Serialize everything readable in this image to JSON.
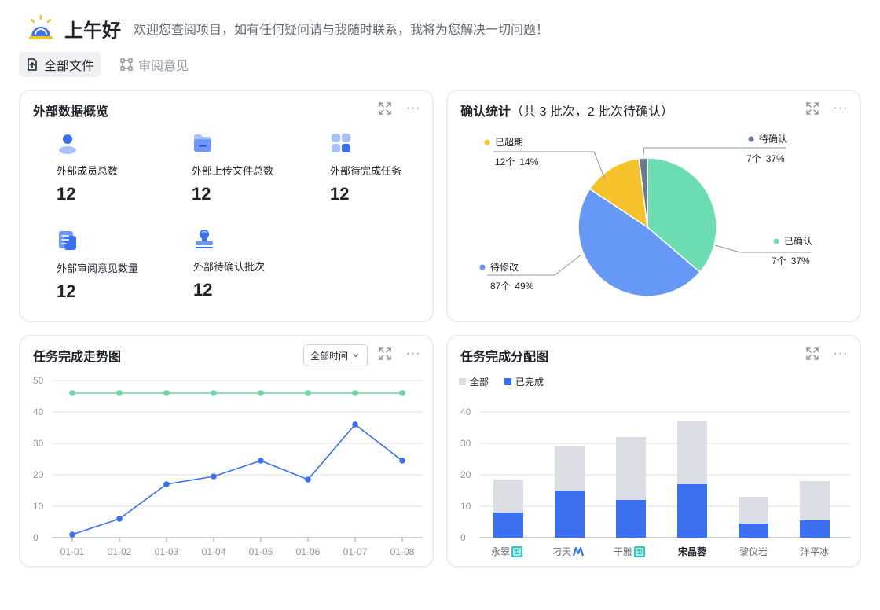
{
  "header": {
    "greeting": "上午好",
    "subtitle": "欢迎您查阅项目，如有任何疑问请与我随时联系，我将为您解决一切问题！"
  },
  "tabs": [
    {
      "label": "全部文件",
      "icon": "upload-file-icon",
      "active": true
    },
    {
      "label": "审阅意见",
      "icon": "annotation-icon",
      "active": false
    }
  ],
  "overview": {
    "title": "外部数据概览",
    "stats": [
      {
        "label": "外部成员总数",
        "value": "12",
        "icon": "user-icon"
      },
      {
        "label": "外部上传文件总数",
        "value": "12",
        "icon": "folder-icon"
      },
      {
        "label": "外部待完成任务",
        "value": "12",
        "icon": "apps-grid-icon"
      },
      {
        "label": "外部审阅意见数量",
        "value": "12",
        "icon": "document-list-icon"
      },
      {
        "label": "外部待确认批次",
        "value": "12",
        "icon": "stamp-icon"
      }
    ]
  },
  "confirm": {
    "title": "确认统计",
    "title_detail": "（共 3 批次，2 批次待确认）",
    "colors": {
      "confirmed": "#6bddb0",
      "to_edit": "#6699f5",
      "overdue": "#f6c22c",
      "pending": "#6b7a92"
    }
  },
  "trend": {
    "title": "任务完成走势图",
    "filter": "全部时间"
  },
  "distribution": {
    "title": "任务完成分配图",
    "legend": [
      "全部",
      "已完成"
    ],
    "highlight_name": "宋晶蓉",
    "badges": [
      "doc-badge-icon",
      "m-logo-icon",
      "doc-badge-icon",
      "",
      "",
      ""
    ]
  },
  "chart_data": [
    {
      "type": "pie",
      "slices": [
        {
          "label": "已确认",
          "count": "7个",
          "percent": "37%",
          "value": 37,
          "color": "#6bddb0"
        },
        {
          "label": "待修改",
          "count": "87个",
          "percent": "49%",
          "value": 49,
          "color": "#6699f5"
        },
        {
          "label": "已超期",
          "count": "12个",
          "percent": "14%",
          "value": 14,
          "color": "#f6c22c"
        },
        {
          "label": "待确认",
          "count": "7个",
          "percent": "37%",
          "value": 2,
          "color": "#6b7a92"
        }
      ]
    },
    {
      "type": "line",
      "categories": [
        "01-01",
        "01-02",
        "01-03",
        "01-04",
        "01-05",
        "01-06",
        "01-07",
        "01-08"
      ],
      "series": [
        {
          "values": [
            46,
            46,
            46,
            46,
            46,
            46,
            46,
            46
          ],
          "color": "#6bd6a4"
        },
        {
          "values": [
            1,
            6,
            17,
            19.5,
            24.5,
            18.5,
            36,
            24.5
          ],
          "color": "#3b70f0"
        }
      ],
      "ylim": [
        0,
        50
      ],
      "yticks": [
        "0",
        "10",
        "20",
        "30",
        "40",
        "50"
      ],
      "grid": true
    },
    {
      "type": "bar",
      "categories": [
        "永翠",
        "刁天",
        "干雅",
        "宋晶蓉",
        "黎仪岩",
        "洋平冰"
      ],
      "series": [
        {
          "name": "全部",
          "values": [
            18.5,
            29,
            32,
            37,
            13,
            18
          ],
          "color": "#dcdee6"
        },
        {
          "name": "已完成",
          "values": [
            8,
            15,
            12,
            17,
            4.5,
            5.5
          ],
          "color": "#3b70f0"
        }
      ],
      "ylim": [
        0,
        40
      ],
      "yticks": [
        "0",
        "10",
        "20",
        "30",
        "40"
      ],
      "grid": true
    }
  ]
}
